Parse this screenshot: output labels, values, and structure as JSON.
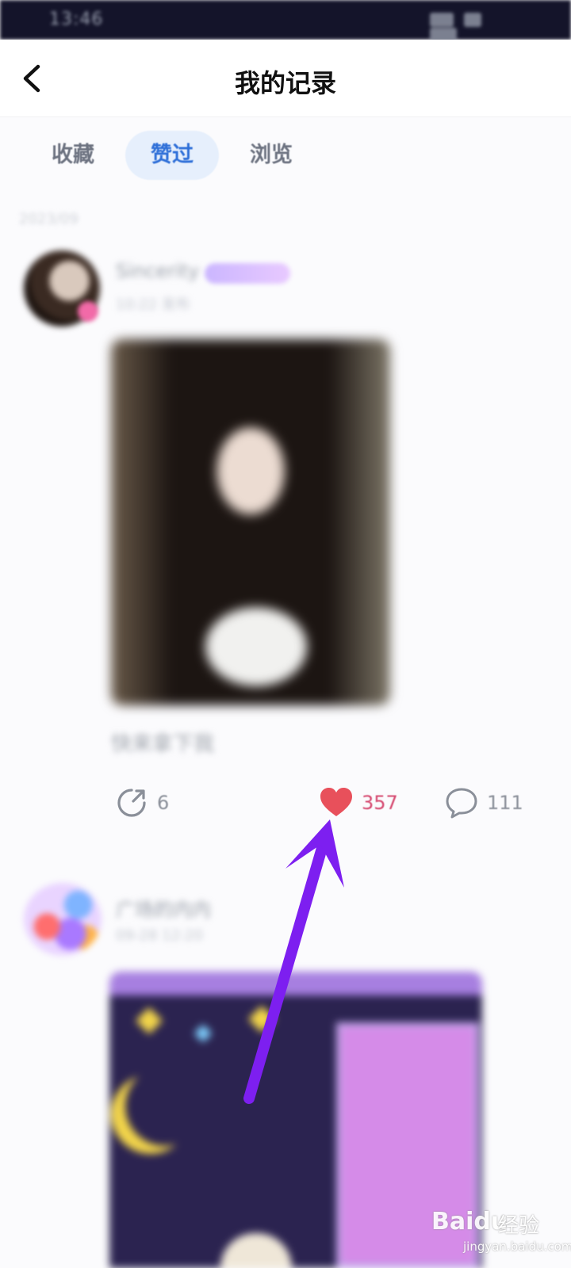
{
  "status_bar": {
    "time": "13:46"
  },
  "header": {
    "title": "我的记录"
  },
  "tabs": [
    {
      "label": "收藏",
      "active": false
    },
    {
      "label": "赞过",
      "active": true
    },
    {
      "label": "浏览",
      "active": false
    }
  ],
  "feed": {
    "date_label": "2023/09",
    "posts": [
      {
        "username": "Sincerity",
        "post_time": "10:22 发布",
        "caption": "快来拿下我",
        "actions": {
          "share_count": "6",
          "like_count": "357",
          "comment_count": "111"
        }
      },
      {
        "username": "广场的内内",
        "post_time": "09-28 12:20"
      }
    ]
  },
  "watermark": {
    "logo": "Baidu",
    "text": "经验",
    "url": "jingyan.baidu.com"
  },
  "colors": {
    "accent_blue": "#2e6fd8",
    "like_red": "#e8505b",
    "like_count": "#d5486f",
    "arrow_purple": "#7d1ff0"
  }
}
